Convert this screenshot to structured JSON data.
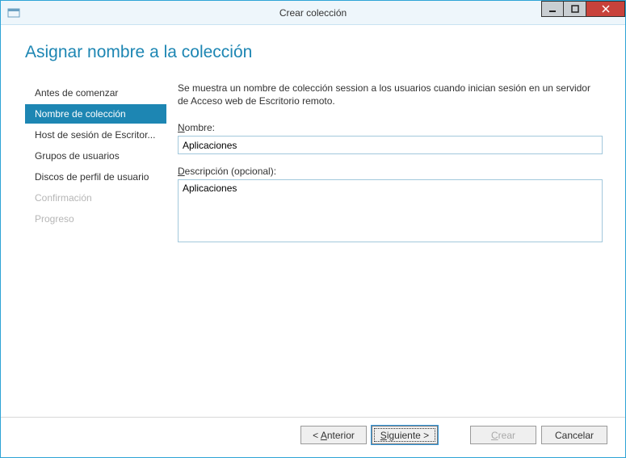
{
  "window": {
    "title": "Crear colección"
  },
  "header": {
    "title": "Asignar nombre a la colección"
  },
  "sidebar": {
    "steps": [
      {
        "label": "Antes de comenzar",
        "state": "done"
      },
      {
        "label": "Nombre de colección",
        "state": "active"
      },
      {
        "label": "Host de sesión de Escritor...",
        "state": "pending"
      },
      {
        "label": "Grupos de usuarios",
        "state": "pending"
      },
      {
        "label": "Discos de perfil de usuario",
        "state": "pending"
      },
      {
        "label": "Confirmación",
        "state": "disabled"
      },
      {
        "label": "Progreso",
        "state": "disabled"
      }
    ]
  },
  "main": {
    "intro": "Se muestra un nombre de colección session a los usuarios cuando inician sesión en un servidor de Acceso web de Escritorio remoto.",
    "name_label_pre": "N",
    "name_label_post": "ombre:",
    "name_value": "Aplicaciones",
    "desc_label_pre": "D",
    "desc_label_post": "escripción (opcional):",
    "desc_value": "Aplicaciones"
  },
  "footer": {
    "prev_pre": "< ",
    "prev_accel": "A",
    "prev_post": "nterior",
    "next_accel": "S",
    "next_post": "iguiente >",
    "create_accel": "C",
    "create_post": "rear",
    "cancel": "Cancelar"
  }
}
